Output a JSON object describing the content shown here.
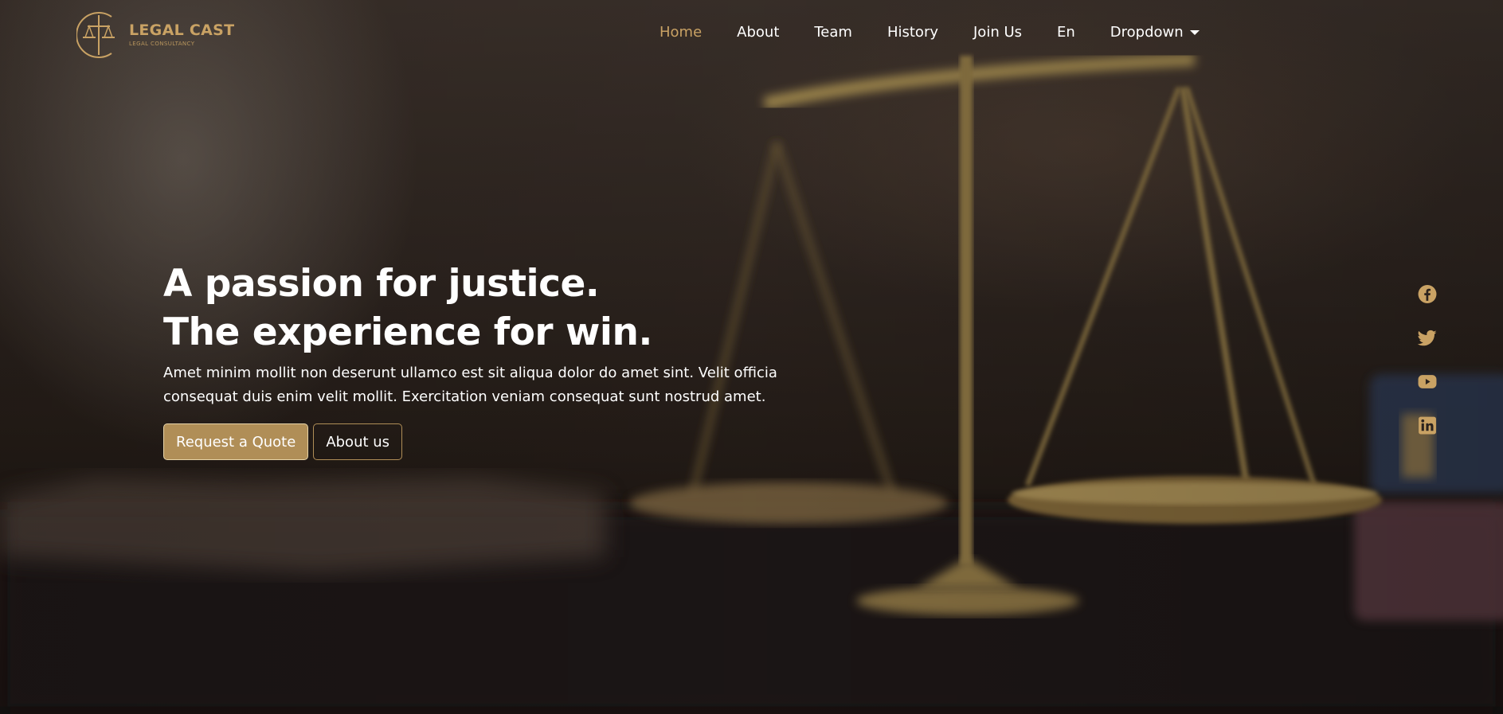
{
  "brand": {
    "name": "LEGAL CAST",
    "tagline": "LEGAL CONSULTANCY",
    "logo_icon": "scales-of-justice-icon",
    "accent_color": "#c9a264"
  },
  "nav": {
    "items": [
      {
        "label": "Home",
        "active": true
      },
      {
        "label": "About",
        "active": false
      },
      {
        "label": "Team",
        "active": false
      },
      {
        "label": "History",
        "active": false
      },
      {
        "label": "Join Us",
        "active": false
      },
      {
        "label": "En",
        "active": false
      },
      {
        "label": "Dropdown",
        "active": false
      }
    ]
  },
  "hero": {
    "title": "A passion for justice. The experience for win.",
    "description": "Amet minim mollit non deserunt ullamco est sit aliqua dolor do amet sint. Velit officia consequat duis enim velit mollit. Exercitation veniam consequat sunt nostrud amet.",
    "primary_button": "Request a Quote",
    "secondary_button": "About us",
    "button_color": "#b08e57",
    "background": "blurred brass scales of justice on a desk"
  },
  "social": {
    "icons": [
      "facebook-icon",
      "twitter-icon",
      "youtube-icon",
      "linkedin-icon"
    ],
    "color": "#c9a264"
  }
}
